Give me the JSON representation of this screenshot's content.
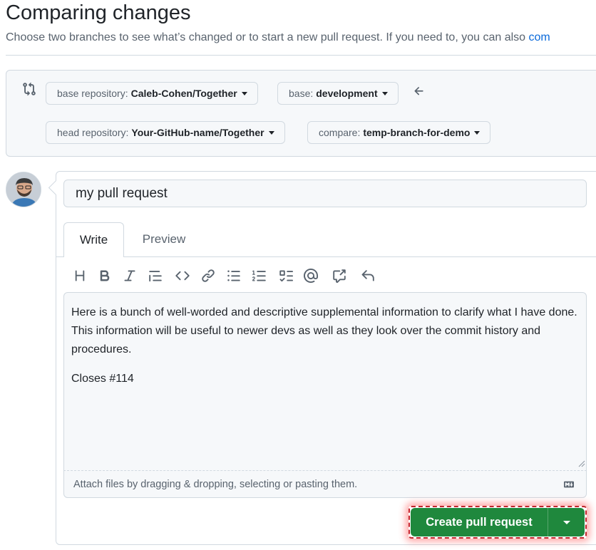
{
  "header": {
    "title": "Comparing changes",
    "subtitle": "Choose two branches to see what’s changed or to start a new pull request. If you need to, you can also ",
    "subtitle_link": "com"
  },
  "range": {
    "base_repo": {
      "label": "base repository:",
      "value": "Caleb-Cohen/Together"
    },
    "base_branch": {
      "label": "base:",
      "value": "development"
    },
    "head_repo": {
      "label": "head repository:",
      "value": "Your-GitHub-name/Together"
    },
    "compare_branch": {
      "label": "compare:",
      "value": "temp-branch-for-demo"
    }
  },
  "composer": {
    "title_value": "my pull request",
    "tabs": [
      {
        "label": "Write",
        "active": true
      },
      {
        "label": "Preview",
        "active": false
      }
    ],
    "toolbar": [
      "heading-icon",
      "bold-icon",
      "italic-icon",
      "quote-icon",
      "code-icon",
      "link-icon",
      "unordered-list-icon",
      "ordered-list-icon",
      "task-list-icon",
      "mention-icon",
      "cross-reference-icon",
      "undo-icon"
    ],
    "body_paragraphs": [
      "Here is a bunch of well-worded and descriptive supplemental information to clarify what I have done. This information will be useful to newer devs as well as they look over the commit history and procedures.",
      "Closes #114"
    ],
    "attach_text": "Attach files by dragging & dropping, selecting or pasting them.",
    "submit_label": "Create pull request"
  },
  "colors": {
    "primary_green": "#1f883d",
    "link_blue": "#0969da",
    "highlight_red": "#c0262d"
  }
}
